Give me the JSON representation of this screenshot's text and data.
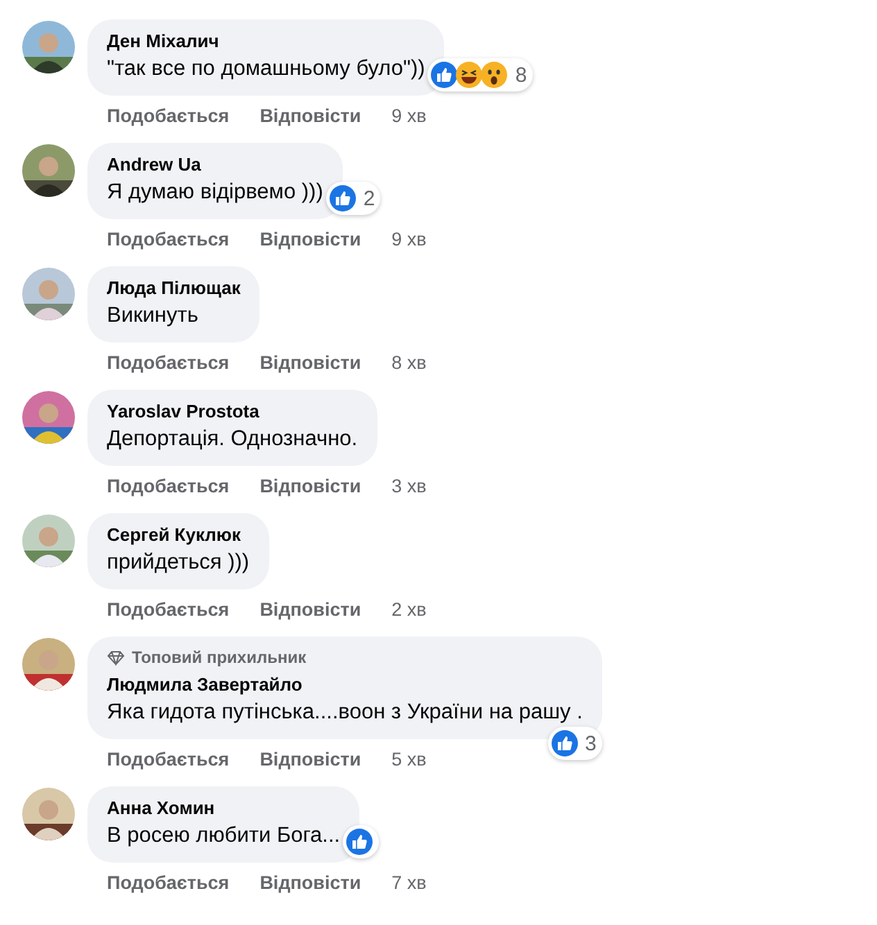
{
  "comments": [
    {
      "author": "Ден Міхалич",
      "text": "\"так все по домашньому було\"))",
      "reactions": {
        "below_bubble": false,
        "icons": [
          {
            "kind": "like"
          },
          {
            "kind": "haha"
          },
          {
            "kind": "wow"
          }
        ],
        "count": "8"
      },
      "actions": [
        "Подобається",
        "Відповісти"
      ],
      "time": "9 хв"
    },
    {
      "author": "Andrew Ua",
      "text": "Я думаю відірвемо )))",
      "reactions": {
        "below_bubble": false,
        "icons": [
          {
            "kind": "like"
          }
        ],
        "count": "2"
      },
      "actions": [
        "Подобається",
        "Відповісти"
      ],
      "time": "9 хв"
    },
    {
      "author": "Люда Пілющак",
      "text": "Викинуть",
      "actions": [
        "Подобається",
        "Відповісти"
      ],
      "time": "8 хв"
    },
    {
      "author": "Yaroslav Prostota",
      "text": "Депортація. Однозначно.",
      "actions": [
        "Подобається",
        "Відповісти"
      ],
      "time": "3 хв"
    },
    {
      "author": "Сергей Куклюк",
      "text": "прийдеться )))",
      "actions": [
        "Подобається",
        "Відповісти"
      ],
      "time": "2 хв"
    },
    {
      "badge": "Топовий прихильник",
      "author": "Людмила Завертайло",
      "text": "Яка гидота путінська....воон з України на рашу .",
      "reactions": {
        "below_bubble": true,
        "icons": [
          {
            "kind": "like"
          }
        ],
        "count": "3"
      },
      "actions": [
        "Подобається",
        "Відповісти"
      ],
      "time": "5 хв"
    },
    {
      "author": "Анна Хомин",
      "text": "В росею любити Бога...",
      "reactions": {
        "below_bubble": false,
        "icons": [
          {
            "kind": "like"
          }
        ]
      },
      "actions": [
        "Подобається",
        "Відповісти"
      ],
      "time": "7 хв"
    }
  ]
}
